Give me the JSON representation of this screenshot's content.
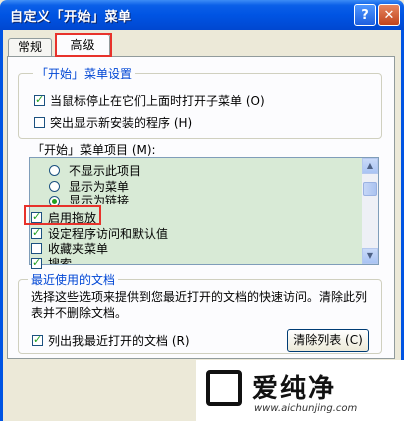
{
  "window": {
    "title": "自定义「开始」菜单",
    "help_button": "?",
    "close_button": "✕"
  },
  "tabs": [
    {
      "label": "常规"
    },
    {
      "label": "高级"
    }
  ],
  "start_menu_settings": {
    "legend": "「开始」菜单设置",
    "options": [
      {
        "label": "当鼠标停止在它们上面时打开子菜单 (O)",
        "checked": true
      },
      {
        "label": "突出显示新安装的程序 (H)",
        "checked": false
      }
    ]
  },
  "start_menu_items": {
    "label": "「开始」菜单项目 (M):",
    "items": [
      {
        "type": "radio",
        "label": "不显示此项目",
        "checked": false
      },
      {
        "type": "radio",
        "label": "显示为菜单",
        "checked": false
      },
      {
        "type": "radio",
        "label": "显示为链接",
        "checked": true
      },
      {
        "type": "checkbox",
        "label": "启用拖放",
        "checked": true
      },
      {
        "type": "checkbox",
        "label": "设定程序访问和默认值",
        "checked": true
      },
      {
        "type": "checkbox",
        "label": "收藏夹菜单",
        "checked": false
      },
      {
        "type": "checkbox",
        "label": "搜索",
        "checked": true
      }
    ]
  },
  "recent_documents": {
    "legend": "最近使用的文档",
    "description": "选择这些选项来提供到您最近打开的文档的快速访问。清除此列表并不删除文档。",
    "list_option": {
      "label": "列出我最近打开的文档 (R)",
      "checked": true
    },
    "clear_button": "清除列表 (C)"
  },
  "watermark": {
    "text": "爱纯净",
    "url": "www.aichunjing.com"
  },
  "colors": {
    "titlebar": "#0054e3",
    "highlight": "#e8322b",
    "list_bg": "#d8ead6",
    "legend": "#0046d5"
  }
}
